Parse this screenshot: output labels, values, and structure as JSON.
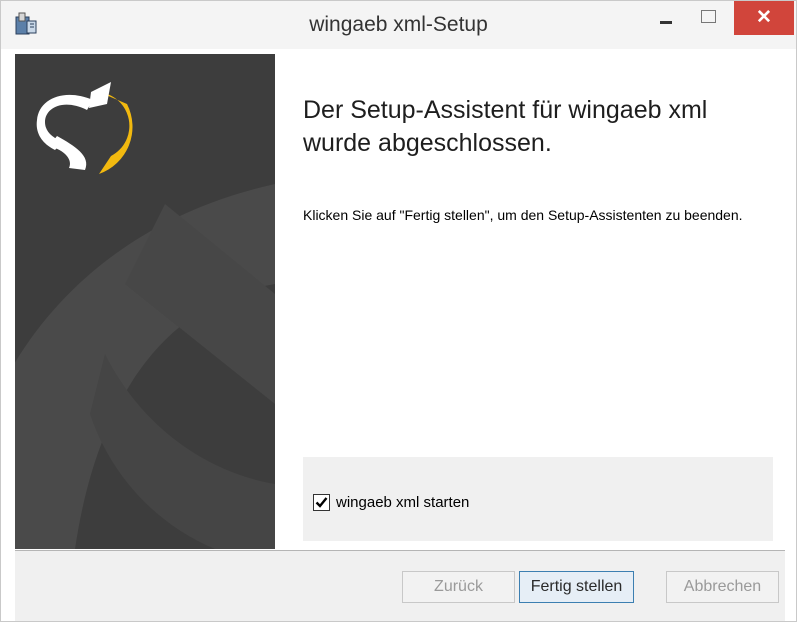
{
  "window": {
    "title": "wingaeb xml-Setup",
    "close_glyph": "✕"
  },
  "content": {
    "heading": "Der Setup-Assistent für wingaeb xml wurde abgeschlossen.",
    "description": "Klicken Sie auf \"Fertig stellen\", um den Setup-Assistenten zu beenden."
  },
  "option": {
    "label": "wingaeb xml starten",
    "checked": true
  },
  "buttons": {
    "back": "Zurück",
    "finish": "Fertig stellen",
    "cancel": "Abbrechen"
  },
  "colors": {
    "sidebar": "#3d3d3d",
    "logo_accent": "#f2b90f",
    "close_button": "#d1453b"
  }
}
